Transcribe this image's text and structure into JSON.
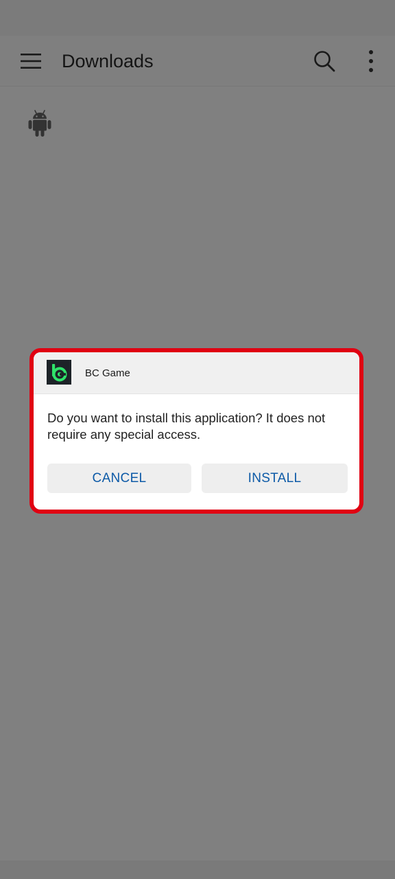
{
  "header": {
    "title": "Downloads",
    "menu_icon": "hamburger-menu-icon",
    "search_icon": "search-icon",
    "more_icon": "more-vert-icon"
  },
  "files": [
    {
      "icon": "android-apk-icon"
    }
  ],
  "dialog": {
    "app_name": "BC Game",
    "app_icon": "bc-game-logo-icon",
    "message": "Do you want to install this application? It does not require any special access.",
    "cancel_label": "CANCEL",
    "install_label": "INSTALL",
    "highlight_color": "#e00012",
    "button_text_color": "#0d5aa7"
  }
}
